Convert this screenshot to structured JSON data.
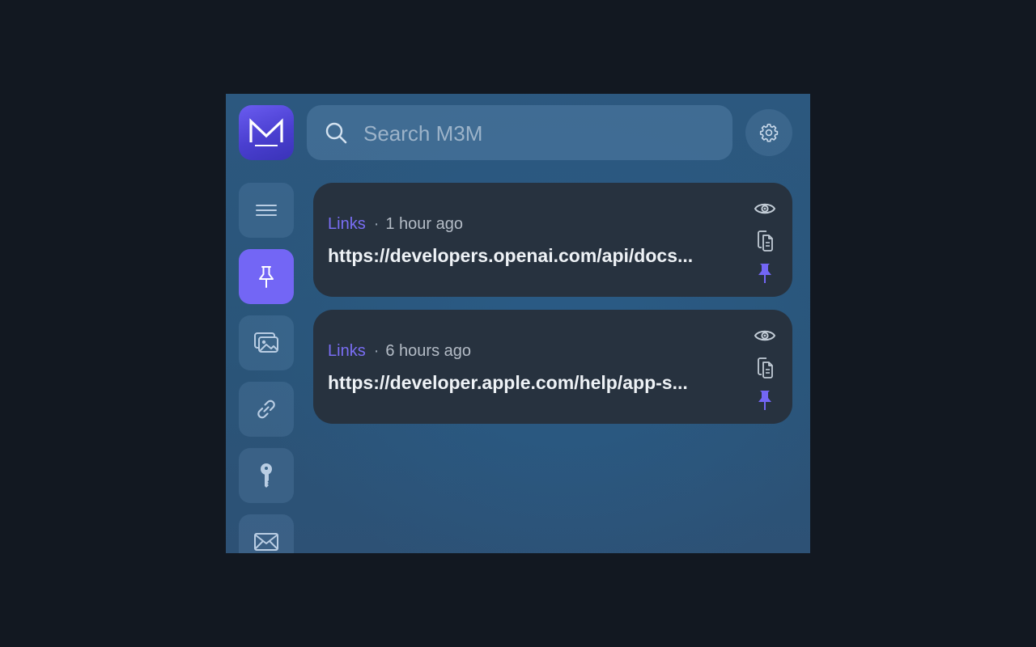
{
  "search": {
    "placeholder": "Search M3M"
  },
  "colors": {
    "accent": "#7366f5",
    "card": "#27323f",
    "background": "#2a5579"
  },
  "sidebar": {
    "items": [
      {
        "name": "all",
        "icon": "menu-icon",
        "active": false
      },
      {
        "name": "pinned",
        "icon": "pin-icon",
        "active": true
      },
      {
        "name": "images",
        "icon": "images-icon",
        "active": false
      },
      {
        "name": "links",
        "icon": "link-icon",
        "active": false
      },
      {
        "name": "passwords",
        "icon": "key-icon",
        "active": false
      },
      {
        "name": "email",
        "icon": "mail-icon",
        "active": false
      }
    ]
  },
  "items": [
    {
      "category": "Links",
      "separator": "·",
      "time": "1 hour ago",
      "url": "https://developers.openai.com/api/docs..."
    },
    {
      "category": "Links",
      "separator": "·",
      "time": "6 hours ago",
      "url": "https://developer.apple.com/help/app-s..."
    }
  ]
}
